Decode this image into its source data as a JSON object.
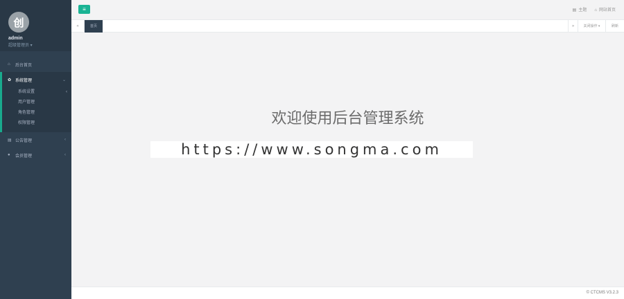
{
  "sidebar": {
    "avatar_glyph": "创",
    "username": "admin",
    "role": "超级管理员 ▾",
    "menu": [
      {
        "label": "后台首页",
        "icon": "home-icon",
        "glyph": "⌂"
      },
      {
        "label": "系统管理",
        "icon": "gear-icon",
        "glyph": "✿",
        "arrow": "⌄",
        "active": true,
        "children": [
          {
            "label": "系统设置",
            "arrow": "‹"
          },
          {
            "label": "用户管理"
          },
          {
            "label": "角色管理"
          },
          {
            "label": "权限管理"
          }
        ]
      },
      {
        "label": "公告管理",
        "icon": "notice-icon",
        "glyph": "▤",
        "arrow": "‹"
      },
      {
        "label": "会员管理",
        "icon": "user-icon",
        "glyph": "●",
        "arrow": "‹"
      }
    ]
  },
  "topbar": {
    "menu_button_glyph": "≡",
    "theme_label": "主题",
    "site_home_label": "网站首页"
  },
  "tabs": {
    "prev_glyph": "«",
    "active_tab": "首页",
    "next_glyph": "»",
    "operations_label": "关闭操作 ▾",
    "refresh_label": "刷新"
  },
  "main": {
    "welcome_text": "欢迎使用后台管理系统",
    "watermark_text": "https://www.songma.com"
  },
  "footer": {
    "text": "© CTCMS V3.2.3"
  }
}
